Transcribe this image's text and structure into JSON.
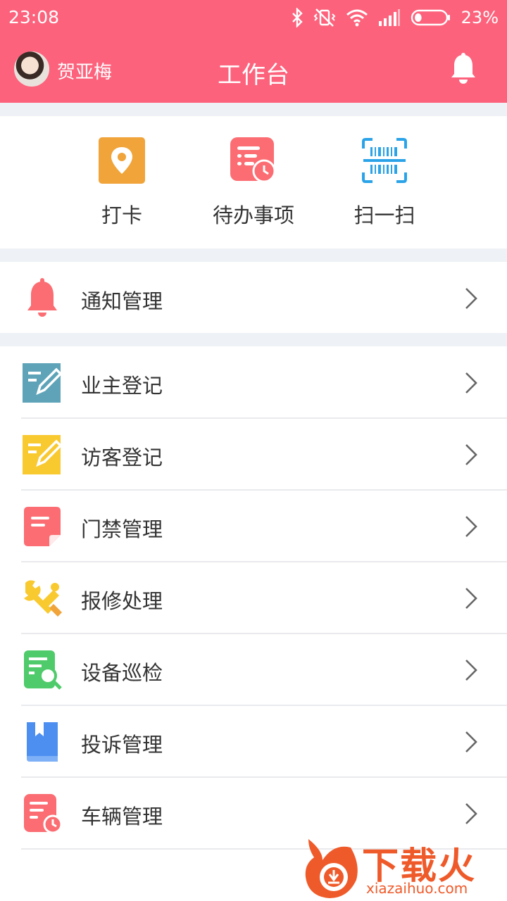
{
  "status_bar": {
    "time": "23:08",
    "battery_percent": "23%",
    "battery_level": 0.23,
    "icons": [
      "bluetooth-icon",
      "vibrate-off-icon",
      "wifi-icon",
      "signal-icon",
      "battery-icon"
    ]
  },
  "header": {
    "user_name": "贺亚梅",
    "title": "工作台",
    "bg_color": "#fd627c",
    "right_icon": "bell-icon"
  },
  "quick_actions": [
    {
      "label": "打卡",
      "icon": "location-pin-icon",
      "color": "#f0a43a"
    },
    {
      "label": "待办事项",
      "icon": "todo-clock-icon",
      "color": "#fb6d72"
    },
    {
      "label": "扫一扫",
      "icon": "barcode-scan-icon",
      "color": "#2ba3e8"
    }
  ],
  "notice": {
    "label": "通知管理",
    "icon": "bell-icon",
    "color": "#fb6d72"
  },
  "menu_items": [
    {
      "label": "业主登记",
      "icon": "edit-form-icon",
      "color": "#5ea3b8"
    },
    {
      "label": "访客登记",
      "icon": "edit-form-icon",
      "color": "#f9c930"
    },
    {
      "label": "门禁管理",
      "icon": "document-icon",
      "color": "#fb6d72"
    },
    {
      "label": "报修处理",
      "icon": "wrench-icon",
      "color": "#f9c930"
    },
    {
      "label": "设备巡检",
      "icon": "inspect-search-icon",
      "color": "#4fcb6b"
    },
    {
      "label": "投诉管理",
      "icon": "bookmark-book-icon",
      "color": "#4d8ff0"
    },
    {
      "label": "车辆管理",
      "icon": "document-clock-icon",
      "color": "#fb6d72"
    }
  ],
  "watermark": {
    "text": "下载火",
    "url": "xiazaihuo.com"
  }
}
